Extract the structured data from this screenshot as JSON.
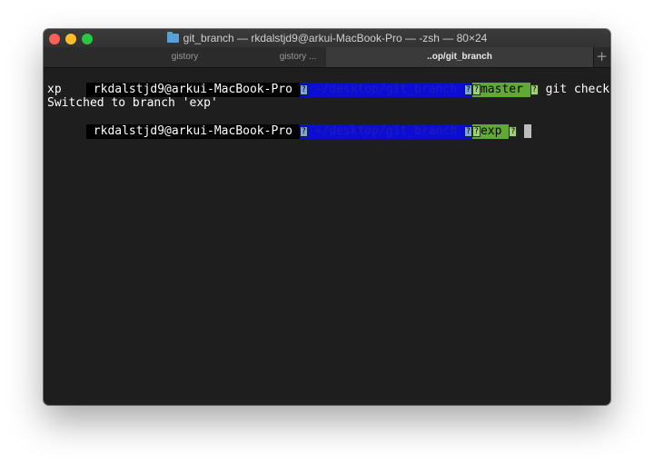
{
  "window": {
    "title": "git_branch — rkdalstjd9@arkui-MacBook-Pro — -zsh — 80×24"
  },
  "tabs": [
    {
      "label": "gistory"
    },
    {
      "label": "gistory ..."
    },
    {
      "label": "..op/git_branch"
    }
  ],
  "tab_add_label": "+",
  "terminal": {
    "prompt1": {
      "user": " rkdalstjd9@arkui-MacBook-Pro ",
      "path": " ~/desktop/git_branch ",
      "icon": "?",
      "branch": "master ",
      "command": "git checkout e"
    },
    "wrap": "xp",
    "output": "Switched to branch 'exp'",
    "prompt2": {
      "user": " rkdalstjd9@arkui-MacBook-Pro ",
      "path": " ~/desktop/git_branch ",
      "icon": "?",
      "branch": "exp "
    }
  }
}
